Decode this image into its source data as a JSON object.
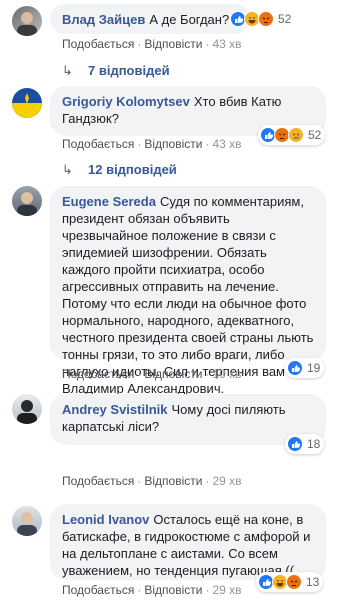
{
  "colors": {
    "link": "#385898",
    "bubble_bg": "#f2f3f5",
    "like": "#2078f4",
    "haha": "#f7b125",
    "angry": "#e9710f"
  },
  "comments": [
    {
      "author": "Влад Зайцев",
      "text": "А де Богдан?",
      "reactions": [
        "like-icon",
        "haha-icon",
        "angry-icon"
      ],
      "reaction_count": "52",
      "like": "Подобається",
      "reply": "Відповісти",
      "time": "43 хв"
    },
    {
      "author": "Grigoriy Kolomytsev",
      "text": "Хто вбив Катю Гандзюк?",
      "reactions": [
        "like-icon",
        "angry-icon",
        "sad-icon"
      ],
      "reaction_count": "52",
      "like": "Подобається",
      "reply": "Відповісти",
      "time": "43 хв"
    },
    {
      "author": "Eugene Sereda",
      "text": "Судя по комментариям, президент обязан объявить чрезвычайное положение в связи с эпидемией шизофрении. Обязать каждого пройти психиатра, особо агрессивных отправить на лечение. Потому что если люди на обычное фото нормального, народного, адекватного, честного президента своей страны льють тонны грязи, то это либо враги, либо наглухо идиоты. Сил и терпения вам Владимир Александрович.",
      "reactions": [
        "like-icon"
      ],
      "reaction_count": "19",
      "like": "Подобається",
      "reply": "Відповісти",
      "time": "10 хв"
    },
    {
      "author": "Andrey Svistilnik",
      "text": "Чому досі пиляють карпатські ліси?",
      "reactions": [
        "like-icon"
      ],
      "reaction_count": "18",
      "like": "Подобається",
      "reply": "Відповісти",
      "time": "29 хв"
    },
    {
      "author": "Leonid Ivanov",
      "text": "Осталось ещё на коне, в батискафе, в гидрокостюме с амфорой и на дельтоплане с аистами. Со всем уважением, но тенденция пугающая ((",
      "reactions": [
        "like-icon",
        "haha-icon",
        "angry-icon"
      ],
      "reaction_count": "13",
      "like": "Подобається",
      "reply": "Відповісти",
      "time": "29 хв"
    }
  ],
  "replies": [
    {
      "label": "7 відповідей"
    },
    {
      "label": "12 відповідей"
    }
  ]
}
